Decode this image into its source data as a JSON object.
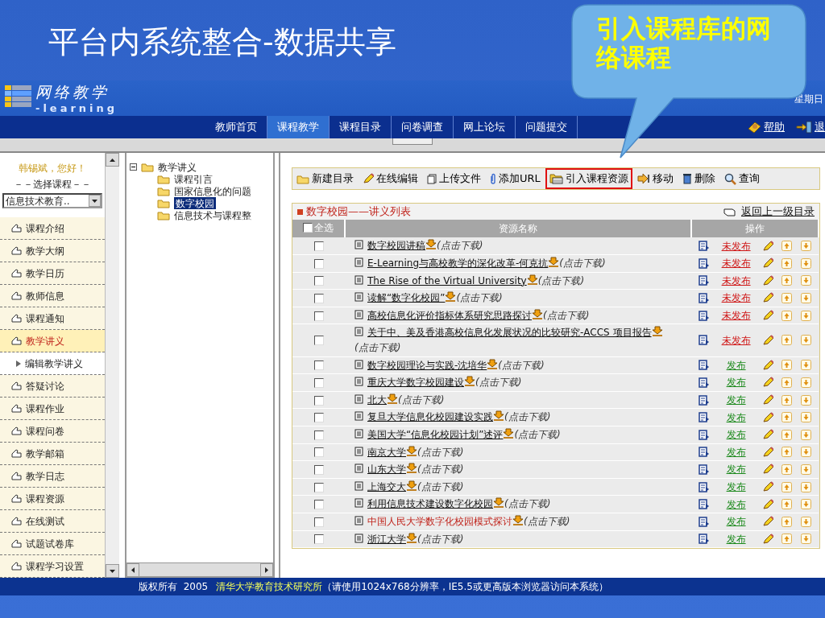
{
  "slide": {
    "title": "平台内系统整合-数据共享"
  },
  "callout": {
    "text": "引入课程库的网络课程"
  },
  "header": {
    "logo_title": "网络教学",
    "logo_subtitle": "-learning",
    "date": "星期日",
    "nav": [
      {
        "label": "教师首页",
        "selected": false
      },
      {
        "label": "课程教学",
        "selected": true
      },
      {
        "label": "课程目录",
        "selected": false
      },
      {
        "label": "问卷调查",
        "selected": false
      },
      {
        "label": "网上论坛",
        "selected": false
      },
      {
        "label": "问题提交",
        "selected": false
      }
    ],
    "links": [
      {
        "label": "帮助",
        "kind": "help"
      },
      {
        "label": "退",
        "kind": "exit"
      }
    ]
  },
  "sidebar": {
    "greeting": "韩锡斌，您好！",
    "select_label": "－－选择课程－－",
    "course_select": "信息技术教育..",
    "items": [
      {
        "label": "课程介绍",
        "selected": false
      },
      {
        "label": "教学大纲",
        "selected": false
      },
      {
        "label": "教学日历",
        "selected": false
      },
      {
        "label": "教师信息",
        "selected": false
      },
      {
        "label": "课程通知",
        "selected": false
      },
      {
        "label": "教学讲义",
        "selected": true,
        "children": [
          {
            "label": "编辑教学讲义",
            "selected": false
          }
        ]
      },
      {
        "label": "答疑讨论",
        "selected": false
      },
      {
        "label": "课程作业",
        "selected": false
      },
      {
        "label": "课程问卷",
        "selected": false
      },
      {
        "label": "教学邮箱",
        "selected": false
      },
      {
        "label": "教学日志",
        "selected": false
      },
      {
        "label": "课程资源",
        "selected": false
      },
      {
        "label": "在线测试",
        "selected": false
      },
      {
        "label": "试题试卷库",
        "selected": false
      },
      {
        "label": "课程学习设置",
        "selected": false
      }
    ]
  },
  "tree": {
    "label": "教学讲义",
    "expanded": true,
    "children": [
      {
        "label": "课程引言",
        "selected": false
      },
      {
        "label": "国家信息化的问题",
        "selected": false
      },
      {
        "label": "数字校园",
        "selected": true
      },
      {
        "label": "信息技术与课程整",
        "selected": false
      }
    ]
  },
  "toolbar": [
    {
      "label": "新建目录",
      "kind": "folder",
      "highlighted": false
    },
    {
      "label": "在线编辑",
      "kind": "pencil",
      "highlighted": false
    },
    {
      "label": "上传文件",
      "kind": "upload",
      "highlighted": false
    },
    {
      "label": "添加URL",
      "kind": "clip",
      "highlighted": false
    },
    {
      "label": "引入课程资源",
      "kind": "import",
      "highlighted": true
    },
    {
      "label": "移动",
      "kind": "move",
      "highlighted": false
    },
    {
      "label": "删除",
      "kind": "trash",
      "highlighted": false
    },
    {
      "label": "查询",
      "kind": "search",
      "highlighted": false
    }
  ],
  "list": {
    "title": "数字校园——讲义列表",
    "back_link": "返回上一级目录",
    "select_all": {
      "label": "全选",
      "checked": false
    },
    "columns": [
      "资源名称",
      "操作"
    ],
    "rows": [
      {
        "name": "数字校园讲稿",
        "download": "(点击下载)",
        "status": "未发布",
        "published": false,
        "checked": false,
        "emphasis": false
      },
      {
        "name": "E-Learning与高校教学的深化改革-何克抗",
        "download": "(点击下载)",
        "status": "未发布",
        "published": false,
        "checked": false,
        "emphasis": false
      },
      {
        "name": "The Rise of the Virtual University",
        "download": "(点击下载)",
        "status": "未发布",
        "published": false,
        "checked": false,
        "emphasis": false
      },
      {
        "name": "读解“数字化校园”",
        "download": "(点击下载)",
        "status": "未发布",
        "published": false,
        "checked": false,
        "emphasis": false
      },
      {
        "name": "高校信息化评价指标体系研究思路探讨",
        "download": "(点击下载)",
        "status": "未发布",
        "published": false,
        "checked": false,
        "emphasis": false
      },
      {
        "name": "关于中、美及香港高校信息化发展状况的比较研究-ACCS 项目报告",
        "download": "(点击下载)",
        "status": "未发布",
        "published": false,
        "checked": false,
        "emphasis": false
      },
      {
        "name": "数字校园理论与实践-沈培华",
        "download": "(点击下载)",
        "status": "发布",
        "published": true,
        "checked": false,
        "emphasis": false
      },
      {
        "name": "重庆大学数字校园建设",
        "download": "(点击下载)",
        "status": "发布",
        "published": true,
        "checked": false,
        "emphasis": false
      },
      {
        "name": "北大",
        "download": "(点击下载)",
        "status": "发布",
        "published": true,
        "checked": false,
        "emphasis": false
      },
      {
        "name": "复旦大学信息化校园建设实践",
        "download": "(点击下载)",
        "status": "发布",
        "published": true,
        "checked": false,
        "emphasis": false
      },
      {
        "name": "美国大学“信息化校园计划”述评",
        "download": "(点击下载)",
        "status": "发布",
        "published": true,
        "checked": false,
        "emphasis": false
      },
      {
        "name": "南京大学",
        "download": "(点击下载)",
        "status": "发布",
        "published": true,
        "checked": false,
        "emphasis": false
      },
      {
        "name": "山东大学",
        "download": "(点击下载)",
        "status": "发布",
        "published": true,
        "checked": false,
        "emphasis": false
      },
      {
        "name": "上海交大",
        "download": "(点击下载)",
        "status": "发布",
        "published": true,
        "checked": false,
        "emphasis": false
      },
      {
        "name": "利用信息技术建设数字化校园",
        "download": "(点击下载)",
        "status": "发布",
        "published": true,
        "checked": false,
        "emphasis": false
      },
      {
        "name": "中国人民大学数字化校园模式探讨",
        "download": "(点击下载)",
        "status": "发布",
        "published": true,
        "checked": false,
        "emphasis": true
      },
      {
        "name": "浙江大学",
        "download": "(点击下载)",
        "status": "发布",
        "published": true,
        "checked": false,
        "emphasis": false
      }
    ]
  },
  "footer": {
    "copyright": "版权所有  2005",
    "org": "清华大学教育技术研究所",
    "note": "（请使用1024x768分辨率，IE5.5或更高版本浏览器访问本系统）"
  }
}
